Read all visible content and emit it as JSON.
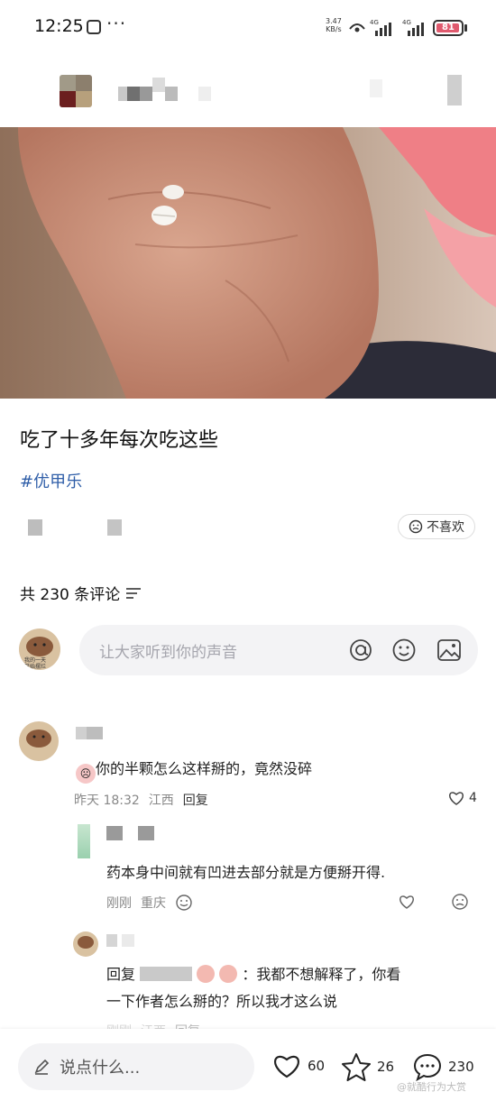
{
  "status_bar": {
    "time": "12:25",
    "more": "···",
    "net_speed_value": "3.47",
    "net_speed_unit": "KB/s",
    "signal_label_1": "4G",
    "signal_label_2": "4G",
    "battery": "81"
  },
  "post": {
    "title": "吃了十多年每次吃这些",
    "hashtag": "#优甲乐",
    "dislike_label": "不喜欢"
  },
  "comments_header": {
    "text": "共 230 条评论"
  },
  "composer": {
    "placeholder": "让大家听到你的声音"
  },
  "avatar_caption": {
    "line1": "我的一天",
    "line2": "开始摆烂"
  },
  "comments": [
    {
      "text": "你的半颗怎么这样掰的，竟然没碎",
      "time": "昨天 18:32",
      "location": "江西",
      "reply_label": "回复",
      "likes": "4",
      "replies": [
        {
          "text": "药本身中间就有凹进去部分就是方便掰开得.",
          "time": "刚刚",
          "location": "重庆"
        },
        {
          "reply_prefix": "回复",
          "text_line1": "：我都不想解释了，你看",
          "text_line2": "一下作者怎么掰的？所以我才这么说",
          "time": "刚刚",
          "location": "江西",
          "reply_label": "回复"
        }
      ]
    }
  ],
  "bottom_bar": {
    "placeholder": "说点什么...",
    "likes": "60",
    "favorites": "26",
    "comments": "230",
    "watermark": "@就酷行为大赏"
  },
  "colors": {
    "accent_blue": "#2f5ea8",
    "battery": "#e05a6e"
  }
}
